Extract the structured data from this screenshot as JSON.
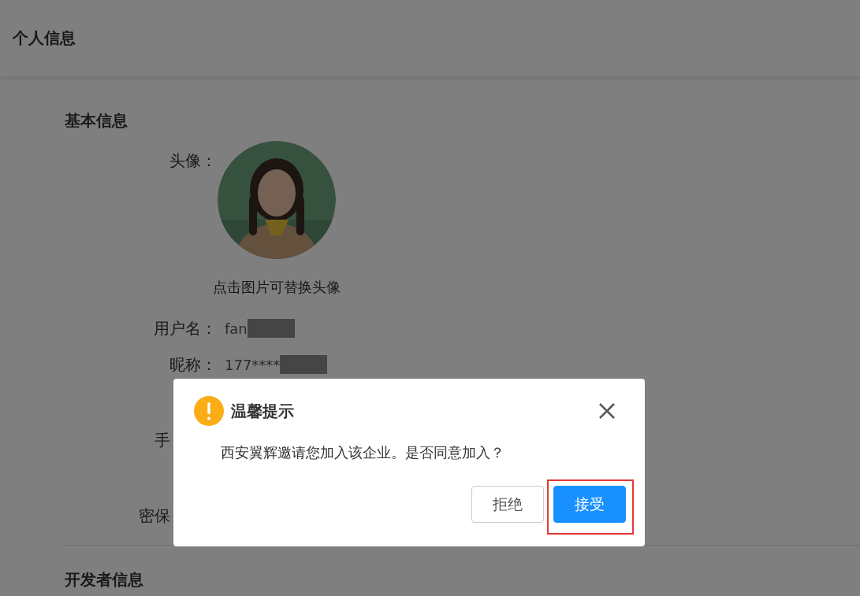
{
  "header": {
    "title": "个人信息"
  },
  "basic_info": {
    "title": "基本信息",
    "avatar_label": "头像：",
    "avatar_caption": "点击图片可替换头像",
    "rows": [
      {
        "kind": "field",
        "label": "用户名：",
        "value": "fan",
        "redacted": true
      },
      {
        "kind": "field",
        "label": "昵称：",
        "value": "177****",
        "redacted": true
      },
      {
        "kind": "cut",
        "label": "手"
      },
      {
        "kind": "cut",
        "label": "密保"
      }
    ]
  },
  "developer_info": {
    "title": "开发者信息"
  },
  "dialog": {
    "title": "温馨提示",
    "message": "西安翼辉邀请您加入该企业。是否同意加入？",
    "buttons": [
      {
        "label": "拒绝",
        "kind": "secondary",
        "highlighted": false
      },
      {
        "label": "接受",
        "kind": "primary",
        "highlighted": true
      }
    ]
  }
}
